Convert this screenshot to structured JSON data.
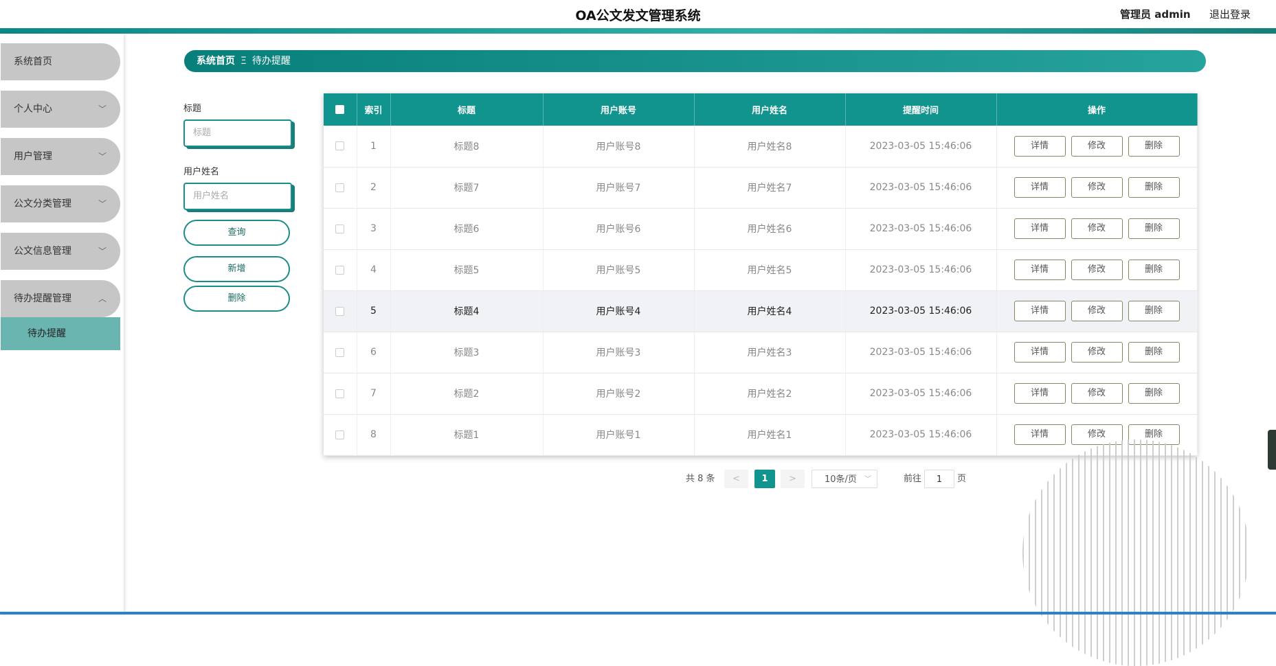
{
  "header": {
    "title": "OA公文发文管理系统",
    "user": "管理员 admin",
    "logout": "退出登录"
  },
  "sidebar": {
    "items": [
      {
        "label": "系统首页",
        "chevron": ""
      },
      {
        "label": "个人中心",
        "chevron": "﹀"
      },
      {
        "label": "用户管理",
        "chevron": "﹀"
      },
      {
        "label": "公文分类管理",
        "chevron": "﹀"
      },
      {
        "label": "公文信息管理",
        "chevron": "﹀"
      },
      {
        "label": "待办提醒管理",
        "chevron": "︿"
      }
    ],
    "active_sub": "待办提醒"
  },
  "breadcrumb": {
    "home": "系统首页",
    "sep": "Ξ",
    "current": "待办提醒"
  },
  "search": {
    "title_label": "标题",
    "title_placeholder": "标题",
    "name_label": "用户姓名",
    "name_placeholder": "用户姓名",
    "query_btn": "查询",
    "add_btn": "新增",
    "delete_btn": "删除"
  },
  "table": {
    "headers": [
      "索引",
      "标题",
      "用户账号",
      "用户姓名",
      "提醒时间",
      "操作"
    ],
    "ops": {
      "detail": "详情",
      "edit": "修改",
      "delete": "删除"
    },
    "rows": [
      {
        "index": "1",
        "title": "标题8",
        "account": "用户账号8",
        "name": "用户姓名8",
        "time": "2023-03-05 15:46:06"
      },
      {
        "index": "2",
        "title": "标题7",
        "account": "用户账号7",
        "name": "用户姓名7",
        "time": "2023-03-05 15:46:06"
      },
      {
        "index": "3",
        "title": "标题6",
        "account": "用户账号6",
        "name": "用户姓名6",
        "time": "2023-03-05 15:46:06"
      },
      {
        "index": "4",
        "title": "标题5",
        "account": "用户账号5",
        "name": "用户姓名5",
        "time": "2023-03-05 15:46:06"
      },
      {
        "index": "5",
        "title": "标题4",
        "account": "用户账号4",
        "name": "用户姓名4",
        "time": "2023-03-05 15:46:06"
      },
      {
        "index": "6",
        "title": "标题3",
        "account": "用户账号3",
        "name": "用户姓名3",
        "time": "2023-03-05 15:46:06"
      },
      {
        "index": "7",
        "title": "标题2",
        "account": "用户账号2",
        "name": "用户姓名2",
        "time": "2023-03-05 15:46:06"
      },
      {
        "index": "8",
        "title": "标题1",
        "account": "用户账号1",
        "name": "用户姓名1",
        "time": "2023-03-05 15:46:06"
      }
    ]
  },
  "pagination": {
    "total": "共 8 条",
    "prev": "<",
    "page": "1",
    "next": ">",
    "page_size": "10条/页",
    "goto_label": "前往",
    "goto_value": "1",
    "page_unit": "页"
  },
  "colors": {
    "accent": "#11948e",
    "sidebar_item": "#c6c6c6",
    "sidebar_active": "#6ab5b0"
  }
}
